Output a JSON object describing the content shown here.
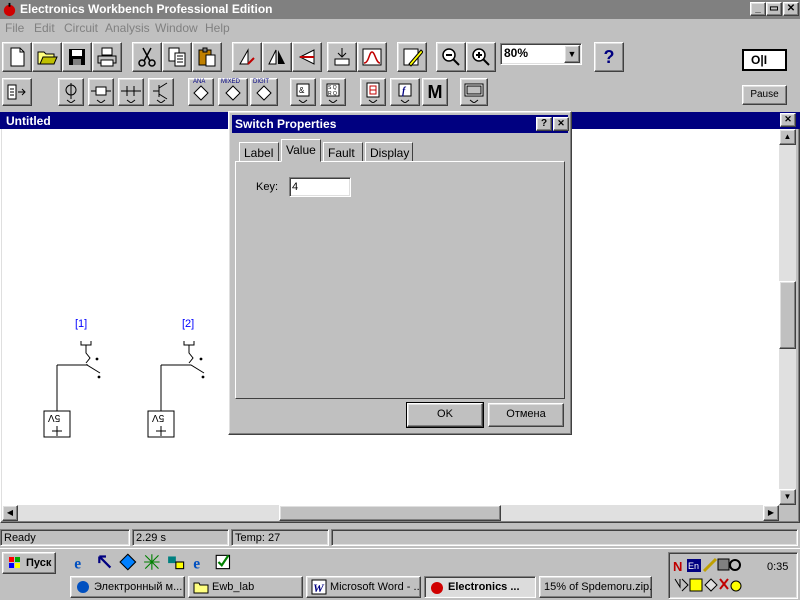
{
  "window": {
    "title": "Electronics Workbench Professional Edition",
    "buttons": {
      "minimize": "_",
      "restore": "▭",
      "close": "✕"
    }
  },
  "menu": [
    "File",
    "Edit",
    "Circuit",
    "Analysis",
    "Window",
    "Help"
  ],
  "toolbar": {
    "zoom_value": "80%",
    "help_label": "?",
    "pause_label": "Pause",
    "power_switch_label": "O|I",
    "parts": [
      "ANA",
      "MIXED",
      "DIGIT"
    ],
    "m_label": "M"
  },
  "document": {
    "title": "Untitled",
    "close": "✕"
  },
  "circuit": {
    "switch1_label": "[1]",
    "switch2_label": "[2]",
    "battery_label": "5V"
  },
  "dialog": {
    "title": "Switch Properties",
    "help": "?",
    "close": "✕",
    "tabs": [
      "Label",
      "Value",
      "Fault",
      "Display"
    ],
    "active_tab": "Value",
    "key_label": "Key:",
    "key_value": "4",
    "ok_label": "OK",
    "cancel_label": "Отмена"
  },
  "status": {
    "state": "Ready",
    "time": "2.29 s",
    "temp": "Temp:  27"
  },
  "taskbar": {
    "start_label": "Пуск",
    "tasks": [
      "Электронный м...",
      "Ewb_lab",
      "Microsoft Word - ...",
      "Electronics ...",
      "15% of Spdemoru.zip..."
    ],
    "clock": "0:35",
    "tray_lang": "En"
  },
  "colors": {
    "titlebar_inactive": "#808080",
    "active_caption": "#000080",
    "face": "#c0c0c0",
    "label_blue": "#0000ff"
  }
}
